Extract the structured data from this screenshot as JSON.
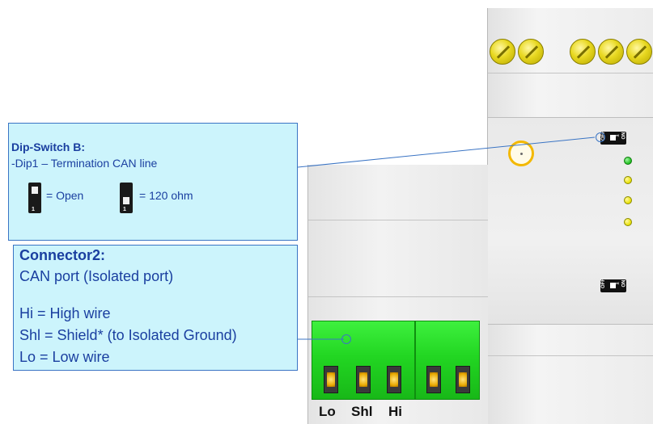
{
  "dip_switch_box": {
    "title": "Dip-Switch B:",
    "dip1_line": "-Dip1 – Termination CAN line",
    "open_label": "= Open",
    "ohm_label": "= 120 ohm",
    "switch_number": "1"
  },
  "connector_box": {
    "title": "Connector2:",
    "subtitle": "CAN port (Isolated port)",
    "hi_line": "Hi = High wire",
    "shl_line": "Shl = Shield* (to Isolated Ground)",
    "lo_line": "Lo = Low wire"
  },
  "terminal_labels": {
    "lo": "Lo",
    "shl": "Shl",
    "hi": "Hi"
  },
  "device_dip": {
    "off": "OFF",
    "one": "1",
    "on": "ON"
  },
  "colors": {
    "callout_fill": "#ccf4fc",
    "callout_border": "#3a74c4",
    "text": "#1a3fa0",
    "connector_green": "#22d622"
  }
}
